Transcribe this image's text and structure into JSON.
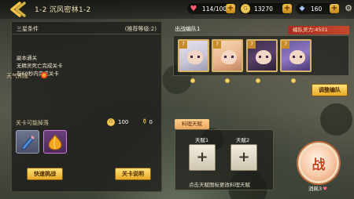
{
  "header": {
    "title": "1-2 沉风密林1-2",
    "stamina": "114/100",
    "coins": "13270",
    "gems": "160"
  },
  "left_panel": {
    "star_title": "三星条件",
    "recommend": "(推荐等级:2)",
    "conditions": [
      "副本通关",
      "无精灵死亡完成关卡",
      "在60秒内完成关卡"
    ],
    "weather_label": "天气预报",
    "drops_label": "关卡可能掉落",
    "coin_reward": "100",
    "exp_reward": "0",
    "quick_button": "快速挑战",
    "skip_button": "关卡说明"
  },
  "team": {
    "label": "出战编队1",
    "power": "编队灵力:4501",
    "heroes": [
      {
        "level": "7"
      },
      {
        "level": "7"
      },
      {
        "level": "7"
      },
      {
        "level": "7"
      }
    ],
    "adjust_button": "调整编队"
  },
  "cooking": {
    "tab": "料理天赋",
    "talent1": "天赋1",
    "talent2": "天赋2",
    "hint": "点击天赋图标更改料理天赋"
  },
  "battle": {
    "button": "战",
    "cost": "消耗3"
  },
  "colors": {
    "accent_gold": "#e7a924",
    "power_red": "#c33a26",
    "cook_tab": "#ffcf8a"
  }
}
